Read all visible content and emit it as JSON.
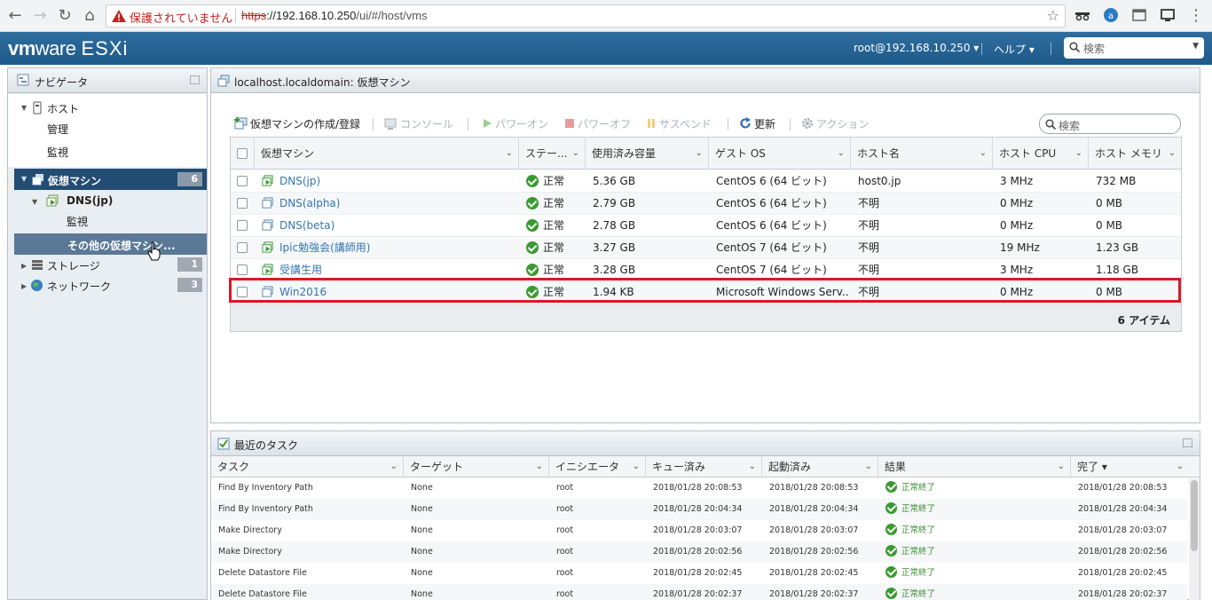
{
  "browser": {
    "insecure_label": "保護されていません",
    "url_scheme": "https",
    "url_host": "://192.168.10.250",
    "url_path": "/ui/#/host/vms"
  },
  "header": {
    "brand_vm": "vm",
    "brand_ware": "ware",
    "brand_esxi": "ESXi",
    "user": "root@192.168.10.250 ▾",
    "help": "ヘルプ ▾",
    "search_placeholder": "検索"
  },
  "navigator": {
    "title": "ナビゲータ",
    "host": "ホスト",
    "host_manage": "管理",
    "host_monitor": "監視",
    "vms": "仮想マシン",
    "vms_count": "6",
    "dns_jp": "DNS(jp)",
    "dns_jp_monitor": "監視",
    "other_vms": "その他の仮想マシン...",
    "storage": "ストレージ",
    "storage_count": "1",
    "network": "ネットワーク",
    "network_count": "3"
  },
  "vm_panel": {
    "title": "localhost.localdomain: 仮想マシン",
    "toolbar": {
      "create": "仮想マシンの作成/登録",
      "console": "コンソール",
      "power_on": "パワーオン",
      "power_off": "パワーオフ",
      "suspend": "サスペンド",
      "refresh": "更新",
      "actions": "アクション"
    },
    "search_placeholder": "検索",
    "columns": [
      "仮想マシン",
      "ステー...",
      "使用済み容量",
      "ゲスト OS",
      "ホスト名",
      "ホスト CPU",
      "ホスト メモリ"
    ],
    "rows": [
      {
        "name": "DNS(jp)",
        "status": "正常",
        "used": "5.36 GB",
        "os": "CentOS 6 (64 ビット)",
        "hostname": "host0.jp",
        "cpu": "3 MHz",
        "mem": "732 MB",
        "on": true
      },
      {
        "name": "DNS(alpha)",
        "status": "正常",
        "used": "2.79 GB",
        "os": "CentOS 6 (64 ビット)",
        "hostname": "不明",
        "cpu": "0 MHz",
        "mem": "0 MB",
        "on": false
      },
      {
        "name": "DNS(beta)",
        "status": "正常",
        "used": "2.78 GB",
        "os": "CentOS 6 (64 ビット)",
        "hostname": "不明",
        "cpu": "0 MHz",
        "mem": "0 MB",
        "on": false
      },
      {
        "name": "Ipic勉強会(講師用)",
        "status": "正常",
        "used": "3.27 GB",
        "os": "CentOS 7 (64 ビット)",
        "hostname": "不明",
        "cpu": "19 MHz",
        "mem": "1.23 GB",
        "on": true
      },
      {
        "name": "受講生用",
        "status": "正常",
        "used": "3.28 GB",
        "os": "CentOS 7 (64 ビット)",
        "hostname": "不明",
        "cpu": "3 MHz",
        "mem": "1.18 GB",
        "on": true
      },
      {
        "name": "Win2016",
        "status": "正常",
        "used": "1.94 KB",
        "os": "Microsoft Windows Serv...",
        "hostname": "不明",
        "cpu": "0 MHz",
        "mem": "0 MB",
        "on": false
      }
    ],
    "item_count": "6 アイテム"
  },
  "tasks": {
    "title": "最近のタスク",
    "columns": [
      "タスク",
      "ターゲット",
      "イニシエータ",
      "キュー済み",
      "起動済み",
      "結果",
      "完了 ▾"
    ],
    "rows": [
      {
        "task": "Find By Inventory Path",
        "target": "None",
        "initiator": "root",
        "queued": "2018/01/28 20:08:53",
        "started": "2018/01/28 20:08:53",
        "result": "正常終了",
        "completed": "2018/01/28 20:08:53"
      },
      {
        "task": "Find By Inventory Path",
        "target": "None",
        "initiator": "root",
        "queued": "2018/01/28 20:04:34",
        "started": "2018/01/28 20:04:34",
        "result": "正常終了",
        "completed": "2018/01/28 20:04:34"
      },
      {
        "task": "Make Directory",
        "target": "None",
        "initiator": "root",
        "queued": "2018/01/28 20:03:07",
        "started": "2018/01/28 20:03:07",
        "result": "正常終了",
        "completed": "2018/01/28 20:03:07"
      },
      {
        "task": "Make Directory",
        "target": "None",
        "initiator": "root",
        "queued": "2018/01/28 20:02:56",
        "started": "2018/01/28 20:02:56",
        "result": "正常終了",
        "completed": "2018/01/28 20:02:56"
      },
      {
        "task": "Delete Datastore File",
        "target": "None",
        "initiator": "root",
        "queued": "2018/01/28 20:02:45",
        "started": "2018/01/28 20:02:45",
        "result": "正常終了",
        "completed": "2018/01/28 20:02:45"
      },
      {
        "task": "Delete Datastore File",
        "target": "None",
        "initiator": "root",
        "queued": "2018/01/28 20:02:37",
        "started": "2018/01/28 20:02:37",
        "result": "正常終了",
        "completed": "2018/01/28 20:02:37"
      }
    ]
  },
  "colors": {
    "header_blue": "#1e5a8a",
    "nav_selected": "#234c73",
    "link_blue": "#3476b4",
    "status_green": "#3a9a30",
    "highlight_red": "#d91a22"
  }
}
